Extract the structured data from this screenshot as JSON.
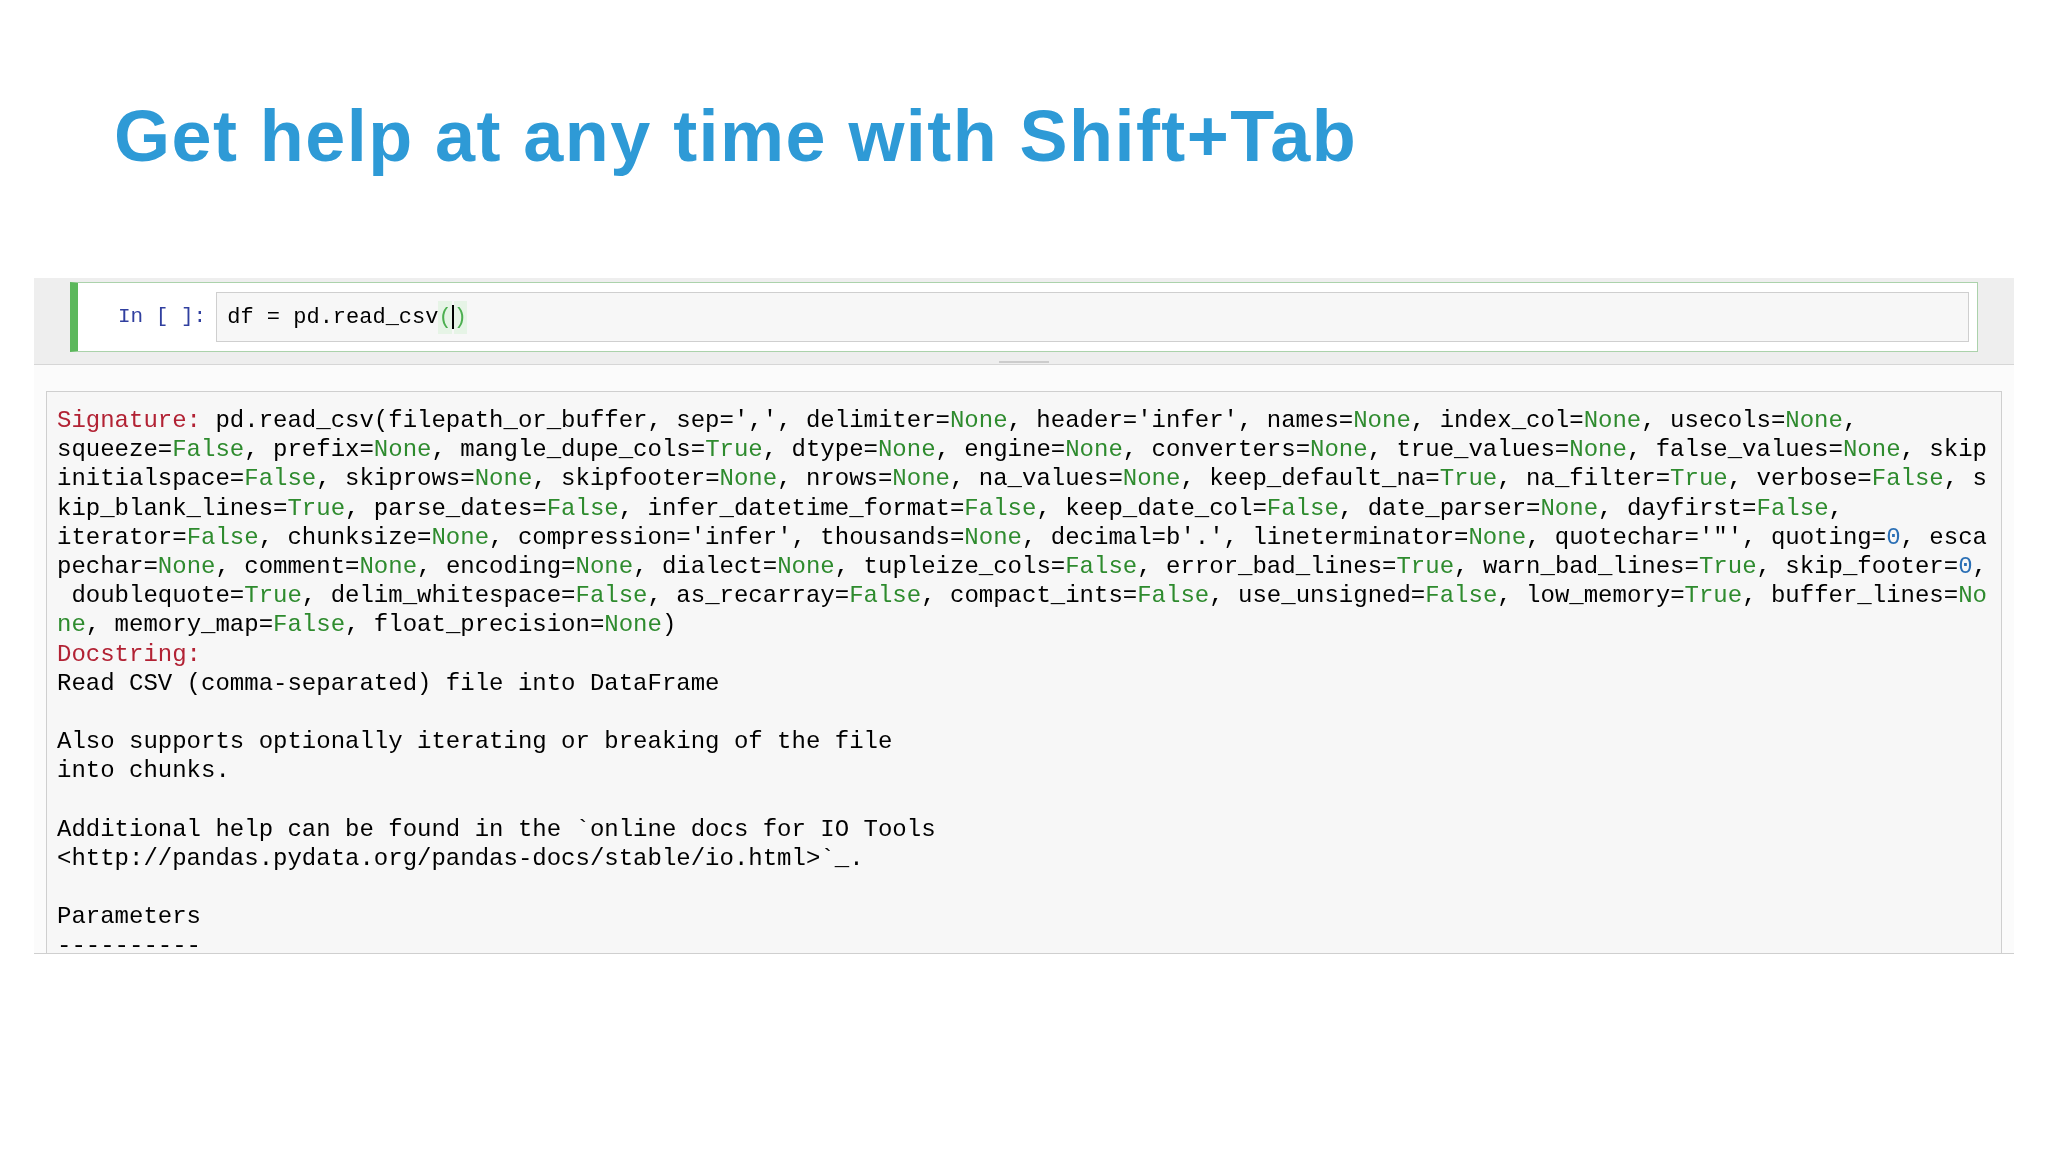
{
  "slide_title": "Get help at any time with Shift+Tab",
  "cell": {
    "prompt": "In [ ]:",
    "code": "df = pd.read_csv",
    "bracket_open": "(",
    "bracket_close": ")"
  },
  "help_pager": {
    "signature_label": "Signature:",
    "signature_lines": [
      [
        {
          "kind": "plain",
          "t": " pd.read_csv(filepath_or_buffer, sep=',', delimiter="
        },
        {
          "kind": "keyword",
          "t": "None"
        },
        {
          "kind": "plain",
          "t": ", header='infer', names="
        },
        {
          "kind": "keyword",
          "t": "None"
        },
        {
          "kind": "plain",
          "t": ", index_col="
        },
        {
          "kind": "keyword",
          "t": "None"
        },
        {
          "kind": "plain",
          "t": ", usecols="
        },
        {
          "kind": "keyword",
          "t": "None"
        },
        {
          "kind": "plain",
          "t": ","
        }
      ],
      [
        {
          "kind": "plain",
          "t": "squeeze="
        },
        {
          "kind": "keyword",
          "t": "False"
        },
        {
          "kind": "plain",
          "t": ", prefix="
        },
        {
          "kind": "keyword",
          "t": "None"
        },
        {
          "kind": "plain",
          "t": ", mangle_dupe_cols="
        },
        {
          "kind": "keyword",
          "t": "True"
        },
        {
          "kind": "plain",
          "t": ", dtype="
        },
        {
          "kind": "keyword",
          "t": "None"
        },
        {
          "kind": "plain",
          "t": ", engine="
        },
        {
          "kind": "keyword",
          "t": "None"
        },
        {
          "kind": "plain",
          "t": ", converters="
        },
        {
          "kind": "keyword",
          "t": "None"
        },
        {
          "kind": "plain",
          "t": ", true_values="
        },
        {
          "kind": "keyword",
          "t": "None"
        },
        {
          "kind": "plain",
          "t": ", false_values="
        },
        {
          "kind": "keyword",
          "t": "None"
        },
        {
          "kind": "plain",
          "t": ", skip"
        }
      ],
      [
        {
          "kind": "plain",
          "t": "initialspace="
        },
        {
          "kind": "keyword",
          "t": "False"
        },
        {
          "kind": "plain",
          "t": ", skiprows="
        },
        {
          "kind": "keyword",
          "t": "None"
        },
        {
          "kind": "plain",
          "t": ", skipfooter="
        },
        {
          "kind": "keyword",
          "t": "None"
        },
        {
          "kind": "plain",
          "t": ", nrows="
        },
        {
          "kind": "keyword",
          "t": "None"
        },
        {
          "kind": "plain",
          "t": ", na_values="
        },
        {
          "kind": "keyword",
          "t": "None"
        },
        {
          "kind": "plain",
          "t": ", keep_default_na="
        },
        {
          "kind": "keyword",
          "t": "True"
        },
        {
          "kind": "plain",
          "t": ", na_filter="
        },
        {
          "kind": "keyword",
          "t": "True"
        },
        {
          "kind": "plain",
          "t": ", verbose="
        },
        {
          "kind": "keyword",
          "t": "False"
        },
        {
          "kind": "plain",
          "t": ", s"
        }
      ],
      [
        {
          "kind": "plain",
          "t": "kip_blank_lines="
        },
        {
          "kind": "keyword",
          "t": "True"
        },
        {
          "kind": "plain",
          "t": ", parse_dates="
        },
        {
          "kind": "keyword",
          "t": "False"
        },
        {
          "kind": "plain",
          "t": ", infer_datetime_format="
        },
        {
          "kind": "keyword",
          "t": "False"
        },
        {
          "kind": "plain",
          "t": ", keep_date_col="
        },
        {
          "kind": "keyword",
          "t": "False"
        },
        {
          "kind": "plain",
          "t": ", date_parser="
        },
        {
          "kind": "keyword",
          "t": "None"
        },
        {
          "kind": "plain",
          "t": ", dayfirst="
        },
        {
          "kind": "keyword",
          "t": "False"
        },
        {
          "kind": "plain",
          "t": ","
        }
      ],
      [
        {
          "kind": "plain",
          "t": "iterator="
        },
        {
          "kind": "keyword",
          "t": "False"
        },
        {
          "kind": "plain",
          "t": ", chunksize="
        },
        {
          "kind": "keyword",
          "t": "None"
        },
        {
          "kind": "plain",
          "t": ", compression='infer', thousands="
        },
        {
          "kind": "keyword",
          "t": "None"
        },
        {
          "kind": "plain",
          "t": ", decimal=b'.', lineterminator="
        },
        {
          "kind": "keyword",
          "t": "None"
        },
        {
          "kind": "plain",
          "t": ", quotechar='\"', quoting="
        },
        {
          "kind": "number",
          "t": "0"
        },
        {
          "kind": "plain",
          "t": ", esca"
        }
      ],
      [
        {
          "kind": "plain",
          "t": "pechar="
        },
        {
          "kind": "keyword",
          "t": "None"
        },
        {
          "kind": "plain",
          "t": ", comment="
        },
        {
          "kind": "keyword",
          "t": "None"
        },
        {
          "kind": "plain",
          "t": ", encoding="
        },
        {
          "kind": "keyword",
          "t": "None"
        },
        {
          "kind": "plain",
          "t": ", dialect="
        },
        {
          "kind": "keyword",
          "t": "None"
        },
        {
          "kind": "plain",
          "t": ", tupleize_cols="
        },
        {
          "kind": "keyword",
          "t": "False"
        },
        {
          "kind": "plain",
          "t": ", error_bad_lines="
        },
        {
          "kind": "keyword",
          "t": "True"
        },
        {
          "kind": "plain",
          "t": ", warn_bad_lines="
        },
        {
          "kind": "keyword",
          "t": "True"
        },
        {
          "kind": "plain",
          "t": ", skip_footer="
        },
        {
          "kind": "number",
          "t": "0"
        },
        {
          "kind": "plain",
          "t": ","
        }
      ],
      [
        {
          "kind": "plain",
          "t": " doublequote="
        },
        {
          "kind": "keyword",
          "t": "True"
        },
        {
          "kind": "plain",
          "t": ", delim_whitespace="
        },
        {
          "kind": "keyword",
          "t": "False"
        },
        {
          "kind": "plain",
          "t": ", as_recarray="
        },
        {
          "kind": "keyword",
          "t": "False"
        },
        {
          "kind": "plain",
          "t": ", compact_ints="
        },
        {
          "kind": "keyword",
          "t": "False"
        },
        {
          "kind": "plain",
          "t": ", use_unsigned="
        },
        {
          "kind": "keyword",
          "t": "False"
        },
        {
          "kind": "plain",
          "t": ", low_memory="
        },
        {
          "kind": "keyword",
          "t": "True"
        },
        {
          "kind": "plain",
          "t": ", buffer_lines="
        },
        {
          "kind": "keyword",
          "t": "No"
        }
      ],
      [
        {
          "kind": "keyword",
          "t": "ne"
        },
        {
          "kind": "plain",
          "t": ", memory_map="
        },
        {
          "kind": "keyword",
          "t": "False"
        },
        {
          "kind": "plain",
          "t": ", float_precision="
        },
        {
          "kind": "keyword",
          "t": "None"
        },
        {
          "kind": "plain",
          "t": ")"
        }
      ]
    ],
    "docstring_label": "Docstring:",
    "docstring_paragraphs": [
      [
        "Read CSV (comma-separated) file into DataFrame"
      ],
      [
        "Also supports optionally iterating or breaking of the file",
        "into chunks."
      ],
      [
        "Additional help can be found in the `online docs for IO Tools",
        "<http://pandas.pydata.org/pandas-docs/stable/io.html>`_."
      ],
      [
        "Parameters",
        "----------"
      ]
    ]
  }
}
